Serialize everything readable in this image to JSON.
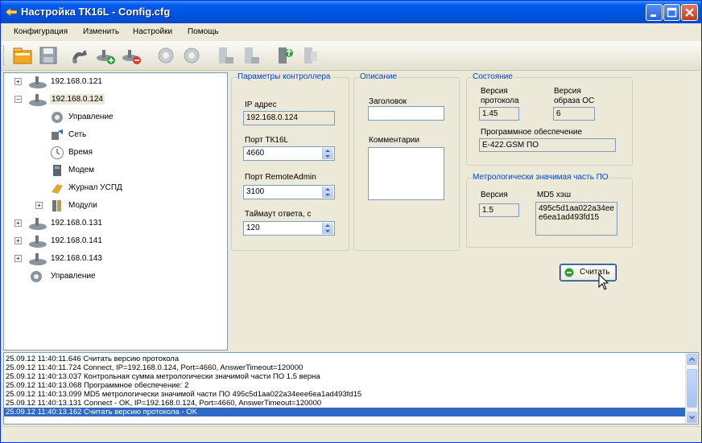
{
  "window": {
    "title": "Настройка ТК16L - Config.cfg"
  },
  "menu": [
    "Конфигурация",
    "Изменить",
    "Настройки",
    "Помощь"
  ],
  "toolbar": {
    "icons": [
      "open-icon",
      "save-icon",
      "connect-icon",
      "add-device-icon",
      "remove-device-icon",
      "settings-gear-icon",
      "settings-gear-2-icon",
      "copy-icon",
      "paste-icon",
      "upload-icon",
      "download-icon"
    ]
  },
  "tree": {
    "items": [
      {
        "label": "192.168.0.121"
      },
      {
        "label": "192.168.0.124"
      },
      {
        "label": "Управление"
      },
      {
        "label": "Сеть"
      },
      {
        "label": "Время"
      },
      {
        "label": "Модем"
      },
      {
        "label": "Журнал УСПД"
      },
      {
        "label": "Модули"
      },
      {
        "label": "192.168.0.131"
      },
      {
        "label": "192.168.0.141"
      },
      {
        "label": "192.168.0.143"
      },
      {
        "label": "Управление"
      }
    ]
  },
  "controller": {
    "title": "Параметры контроллера",
    "ip_label": "IP адрес",
    "ip_value": "192.168.0.124",
    "port_label": "Порт ТК16L",
    "port_value": "4660",
    "remote_label": "Порт RemoteAdmin",
    "remote_value": "3100",
    "timeout_label": "Таймаут ответа, с",
    "timeout_value": "120"
  },
  "description": {
    "title": "Описание",
    "header_label": "Заголовок",
    "header_value": "",
    "comments_label": "Комментарии",
    "comments_value": ""
  },
  "state": {
    "title": "Состояние",
    "proto_label": "Версия протокола",
    "proto_value": "1.45",
    "os_label": "Версия образа ОС",
    "os_value": "6",
    "software_label": "Программное обеспечение",
    "software_value": "E-422.GSM ПО"
  },
  "metrology": {
    "title": "Метрологически значимая часть ПО",
    "version_label": "Версия",
    "version_value": "1.5",
    "hash_label": "MD5 хэш",
    "hash_value": "495c5d1aa022a34eee6ea1ad493fd15"
  },
  "read_button": "Считать",
  "log": [
    "25.09.12 11:40:11.646 Считать версию протокола",
    "25.09.12 11:40:11.724 Connect, IP=192.168.0.124, Port=4660, AnswerTimeout=120000",
    "25.09.12 11:40:13.037 Контрольная сумма метрологически значимой части ПО 1.5 верна",
    "25.09.12 11:40:13.068 Программное обеспечение: 2",
    "25.09.12 11:40:13.099 MD5  метрологически значимой части ПО 495c5d1aa022a34eee6ea1ad493fd15",
    "25.09.12 11:40:13.131 Connect - OK, IP=192.168.0.124, Port=4660, AnswerTimeout=120000",
    "25.09.12 11:40:13.162 Считать версию протокола - OK"
  ]
}
